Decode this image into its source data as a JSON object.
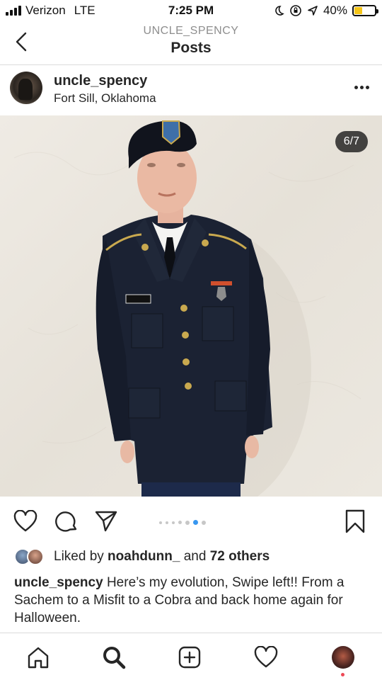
{
  "status_bar": {
    "carrier": "Verizon",
    "network": "LTE",
    "time": "7:25 PM",
    "battery_percent": "40%",
    "battery_level": 0.4,
    "battery_color": "#f5c518"
  },
  "header": {
    "subtitle": "UNCLE_SPENCY",
    "title": "Posts"
  },
  "post": {
    "username": "uncle_spency",
    "location": "Fort Sill, Oklahoma",
    "counter": "6/7",
    "carousel_total": 7,
    "carousel_current": 6,
    "likes": {
      "prefix": "Liked by ",
      "user": "noahdunn_",
      "middle": " and ",
      "others": "72 others"
    },
    "caption_user": "uncle_spency",
    "caption_text": " Here’s my evolution, Swipe left!! From a Sachem to a Misfit to a Cobra and back home again for Halloween."
  },
  "icons": {
    "back": "chevron-left-icon",
    "more": "more-horizontal-icon",
    "like": "heart-icon",
    "comment": "comment-icon",
    "share": "send-icon",
    "save": "bookmark-icon",
    "home": "home-icon",
    "search": "search-icon",
    "new_post": "add-post-icon",
    "activity": "heart-icon",
    "profile": "profile-avatar"
  },
  "colors": {
    "active_dot": "#3897f0",
    "notification_dot": "#ed4956"
  }
}
